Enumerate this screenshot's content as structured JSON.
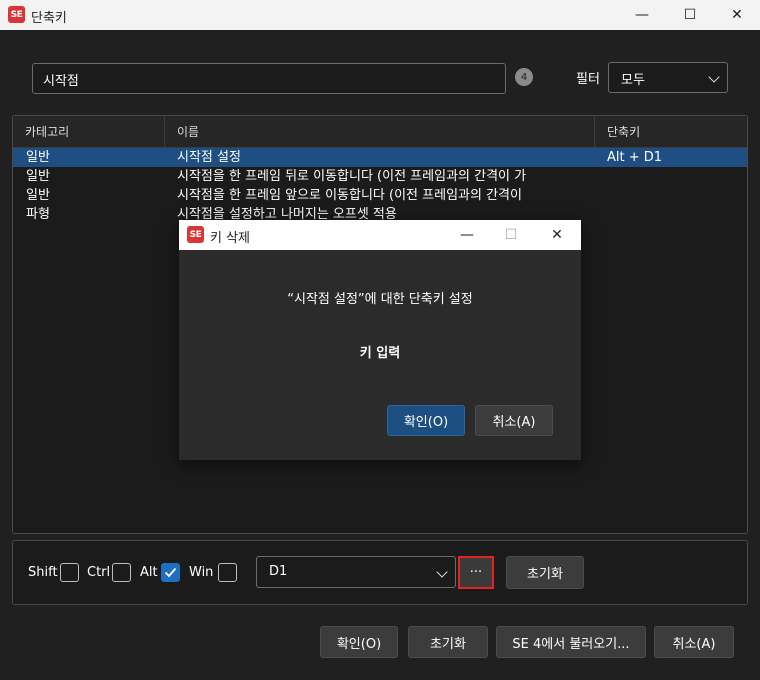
{
  "window": {
    "logo": "SE",
    "title": "단축키",
    "controls": {
      "minimize": "—",
      "maximize": "☐",
      "close": "✕"
    }
  },
  "search": {
    "value": "시작점",
    "result_count": "4"
  },
  "filter": {
    "label": "필터",
    "selected": "모두"
  },
  "table": {
    "columns": [
      "카테고리",
      "이름",
      "단축키"
    ],
    "rows": [
      {
        "category": "일반",
        "name": "시작점 설정",
        "shortcut": "Alt + D1",
        "selected": true
      },
      {
        "category": "일반",
        "name": "시작점을 한 프레임 뒤로 이동합니다 (이전 프레임과의 간격이 가",
        "shortcut": ""
      },
      {
        "category": "일반",
        "name": "시작점을 한 프레임 앞으로 이동합니다 (이전 프레임과의 간격이",
        "shortcut": ""
      },
      {
        "category": "파형",
        "name": "시작점을 설정하고 나머지는 오프셋 적용",
        "shortcut": ""
      }
    ]
  },
  "dialog": {
    "logo": "SE",
    "title": "키 삭제",
    "message": "“시작점 설정”에 대한 단축키 설정",
    "key_prompt": "키 입력",
    "ok_label": "확인(O)",
    "cancel_label": "취소(A)"
  },
  "modifiers": {
    "shift": {
      "label": "Shift",
      "checked": false
    },
    "ctrl": {
      "label": "Ctrl",
      "checked": false
    },
    "alt": {
      "label": "Alt",
      "checked": true
    },
    "win": {
      "label": "Win",
      "checked": false
    }
  },
  "key_select": {
    "value": "D1",
    "browse_label": "···",
    "reset_label": "초기화"
  },
  "footer": {
    "ok_label": "확인(O)",
    "reset_label": "초기화",
    "import_label": "SE 4에서 불러오기...",
    "cancel_label": "취소(A)"
  },
  "colors": {
    "accent": "#1f6fc1",
    "selection": "#1e4e82",
    "highlight_border": "#e52222",
    "brand": "#d93636"
  }
}
